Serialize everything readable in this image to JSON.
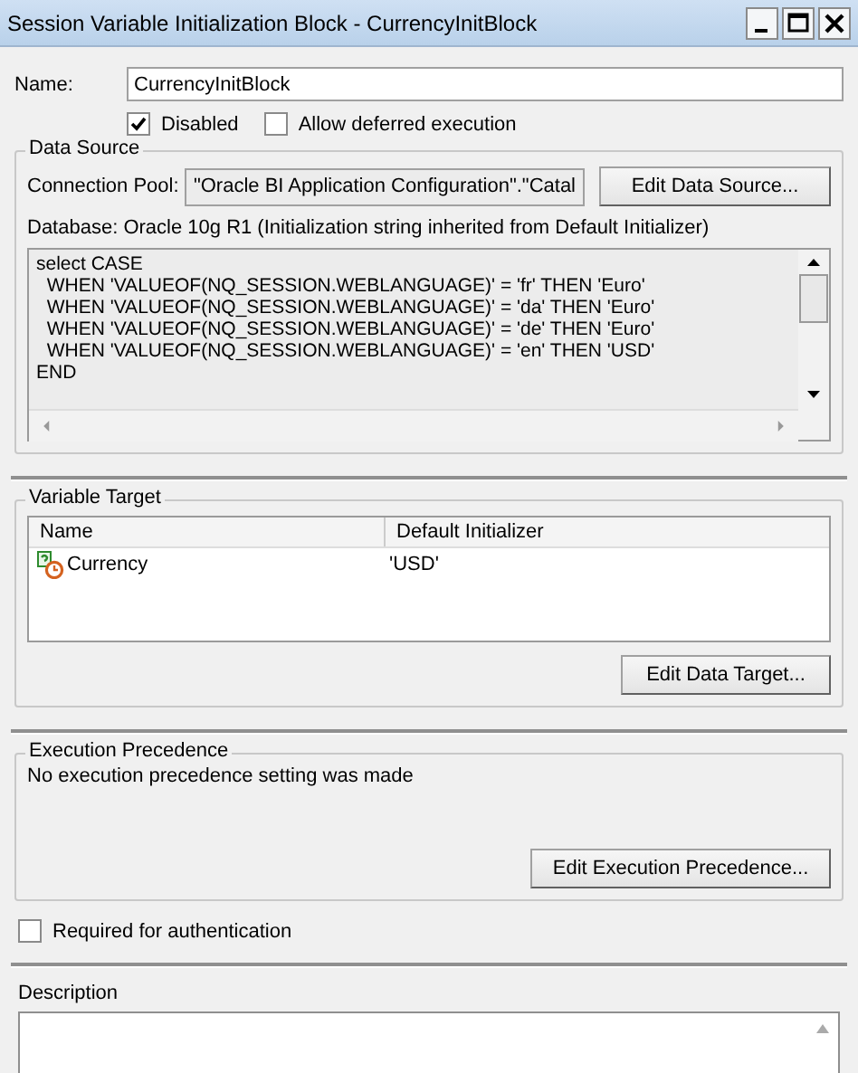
{
  "window": {
    "title": "Session Variable Initialization Block - CurrencyInitBlock"
  },
  "name_field": {
    "label": "Name:",
    "value": "CurrencyInitBlock"
  },
  "options": [
    {
      "label": "Disabled",
      "checked": true
    },
    {
      "label": "Allow deferred execution",
      "checked": false
    }
  ],
  "data_source": {
    "title": "Data Source",
    "connection_pool_label": "Connection Pool:",
    "connection_pool_value": "\"Oracle BI Application Configuration\".\"Catal",
    "edit_button": "Edit Data Source...",
    "database_note": "Database: Oracle 10g R1 (Initialization string inherited from Default Initializer)",
    "sql_lines": [
      "select CASE",
      "  WHEN 'VALUEOF(NQ_SESSION.WEBLANGUAGE)' = 'fr' THEN 'Euro'",
      "  WHEN 'VALUEOF(NQ_SESSION.WEBLANGUAGE)' = 'da' THEN 'Euro'",
      "  WHEN 'VALUEOF(NQ_SESSION.WEBLANGUAGE)' = 'de' THEN 'Euro'",
      "  WHEN 'VALUEOF(NQ_SESSION.WEBLANGUAGE)' = 'en' THEN 'USD'",
      "END"
    ]
  },
  "variable_target": {
    "title": "Variable Target",
    "columns": [
      "Name",
      "Default Initializer"
    ],
    "rows": [
      {
        "name": "Currency",
        "default_initializer": "'USD'"
      }
    ],
    "edit_button": "Edit Data Target..."
  },
  "execution_precedence": {
    "title": "Execution Precedence",
    "message": "No execution precedence setting was made",
    "edit_button": "Edit Execution Precedence..."
  },
  "required_for_authentication": {
    "label": "Required for authentication",
    "checked": false
  },
  "description": {
    "label": "Description"
  }
}
